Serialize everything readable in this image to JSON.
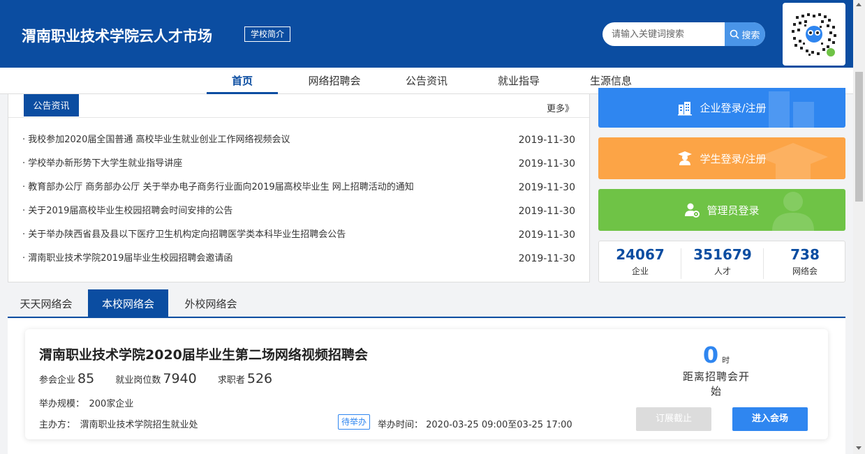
{
  "header": {
    "title": "渭南职业技术学院云人才市场",
    "school_intro": "学校简介",
    "search_placeholder": "请输入关键词搜索",
    "search_button": "搜索",
    "bg_color": "#0b4da1"
  },
  "nav": {
    "items": [
      {
        "label": "首页",
        "active": true
      },
      {
        "label": "网络招聘会",
        "active": false
      },
      {
        "label": "公告资讯",
        "active": false
      },
      {
        "label": "就业指导",
        "active": false
      },
      {
        "label": "生源信息",
        "active": false
      }
    ]
  },
  "news": {
    "tab_label": "公告资讯",
    "more_label": "更多》",
    "items": [
      {
        "title": "· 我校参加2020届全国普通 高校毕业生就业创业工作网络视频会议",
        "date": "2019-11-30"
      },
      {
        "title": "· 学校举办新形势下大学生就业指导讲座",
        "date": "2019-11-30"
      },
      {
        "title": "· 教育部办公厅 商务部办公厅 关于举办电子商务行业面向2019届高校毕业生 网上招聘活动的通知",
        "date": "2019-11-30"
      },
      {
        "title": "· 关于2019届高校毕业生校园招聘会时间安排的公告",
        "date": "2019-11-30"
      },
      {
        "title": "· 关于举办陕西省县及县以下医疗卫生机构定向招聘医学类本科毕业生招聘会公告",
        "date": "2019-11-30"
      },
      {
        "title": "· 渭南职业技术学院2019届毕业生校园招聘会邀请函",
        "date": "2019-11-30"
      }
    ]
  },
  "login_cards": {
    "company": {
      "label": "企业登录/注册",
      "color": "#2f86f0",
      "icon": "building-icon"
    },
    "student": {
      "label": "学生登录/注册",
      "color": "#fca446",
      "icon": "graduate-icon"
    },
    "admin": {
      "label": "管理员登录",
      "color": "#6fc346",
      "icon": "admin-icon"
    }
  },
  "stats": [
    {
      "value": "24067",
      "label": "企业"
    },
    {
      "value": "351679",
      "label": "人才"
    },
    {
      "value": "738",
      "label": "网络会"
    }
  ],
  "fair_tabs": [
    {
      "label": "天天网络会",
      "active": false
    },
    {
      "label": "本校网络会",
      "active": true
    },
    {
      "label": "外校网络会",
      "active": false
    }
  ],
  "fair": {
    "title": "渭南职业技术学院2020届毕业生第二场网络视频招聘会",
    "companies_label": "参会企业",
    "companies": "85",
    "positions_label": "就业岗位数",
    "positions": "7940",
    "seekers_label": "求职者",
    "seekers": "526",
    "scale": "举办规模：　200家企业",
    "organizer": "主办方：　渭南职业技术学院招生就业处",
    "status_badge": "待举办",
    "time": "举办时间：  2020-03-25 09:00至03-25 17:00",
    "countdown_value": "0",
    "countdown_unit": "时",
    "countdown_text": "距离招聘会开始",
    "subscribe_button": "订展截止",
    "enter_button": "进入会场"
  }
}
